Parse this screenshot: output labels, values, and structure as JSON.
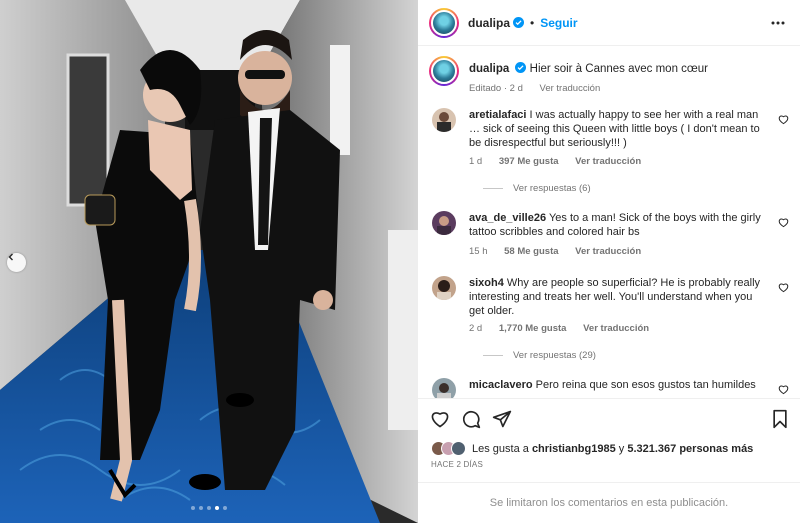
{
  "header": {
    "username": "dualipa",
    "separator": "•",
    "follow_label": "Seguir",
    "more_icon": "more-options-icon"
  },
  "caption": {
    "username": "dualipa",
    "text": "Hier soir à Cannes avec mon cœur",
    "edited": "Editado · 2 d",
    "translate": "Ver traducción"
  },
  "comments": [
    {
      "username": "aretialafaci",
      "text": "I was actually happy to see her with a real man … sick of seeing this Queen with little boys ( I don't mean to be disrespectful but seriously!!! )",
      "age": "1 d",
      "likes": "397 Me gusta",
      "translate": "Ver traducción",
      "replies": "Ver respuestas (6)"
    },
    {
      "username": "ava_de_ville26",
      "text": "Yes to a man! Sick of the boys with the girly tattoo scribbles and colored hair bs",
      "age": "15 h",
      "likes": "58 Me gusta",
      "translate": "Ver traducción",
      "replies": ""
    },
    {
      "username": "sixoh4",
      "text": "Why are people so superficial? He is probably really interesting and treats her well. You'll understand when you get older.",
      "age": "2 d",
      "likes": "1,770 Me gusta",
      "translate": "Ver traducción",
      "replies": "Ver respuestas (29)"
    },
    {
      "username": "micaclavero",
      "text": "Pero reina que son esos gustos tan humildes",
      "age": "",
      "likes": "",
      "translate": "",
      "replies": ""
    }
  ],
  "likes": {
    "prefix": "Les gusta a",
    "first_user": "christianbg1985",
    "joiner": "y",
    "count_text": "5.321.367 personas más"
  },
  "posted_ago": "HACE 2 DÍAS",
  "footer": "Se limitaron los comentarios en esta publicación.",
  "carousel": {
    "total": 5,
    "active": 4
  },
  "colors": {
    "accent": "#0095f6",
    "verified": "#0095f6",
    "muted": "#737373"
  }
}
